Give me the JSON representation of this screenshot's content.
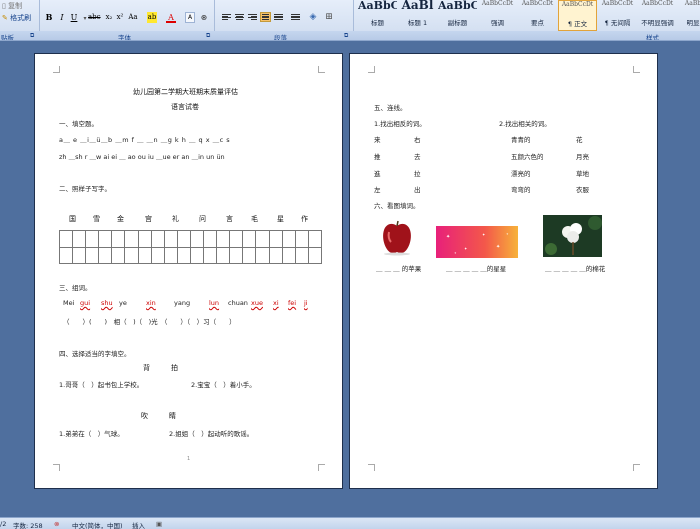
{
  "clipboard": {
    "cut_label": "剪切",
    "copy_label": "复制",
    "format_painter_label": "格式刷"
  },
  "groups": {
    "clipboard": "贴板",
    "font": "字体",
    "paragraph": "段落",
    "styles": "样式"
  },
  "font_toolbar": {
    "bold": "B",
    "italic": "I",
    "underline": "U",
    "strikethrough": "abc",
    "subscript": "x₂",
    "superscript": "x²",
    "change_case": "Aa",
    "highlight": "ab",
    "font_color": "A",
    "char_border": "A",
    "phonetic": "A"
  },
  "styles": [
    {
      "sample": "AaBbC",
      "name": "标题"
    },
    {
      "sample": "AaBl",
      "name": "标题 1"
    },
    {
      "sample": "AaBbC",
      "name": "副标题"
    },
    {
      "sample": "AaBbCcDt",
      "name": "强调"
    },
    {
      "sample": "AaBbCcDt",
      "name": "要点"
    },
    {
      "sample": "AaBbCcDt",
      "name": "正文"
    },
    {
      "sample": "AaBbCcDt",
      "name": "无间隔"
    },
    {
      "sample": "AaBbCcDt",
      "name": "不明显强调"
    },
    {
      "sample": "AaBb",
      "name": "明显"
    }
  ],
  "page1": {
    "title": "幼儿园第二学期大班期末质量评估",
    "subtitle": "语言试卷",
    "sec1": "一、填空题。",
    "fill_row1": "a＿ e ＿i＿ü＿b ＿m f ＿ ＿n ＿g k h ＿ q x ＿c s",
    "fill_row2": [
      "zh",
      "＿sh r",
      "＿w",
      "ai",
      "ei",
      "＿",
      "ao",
      "ou",
      "iu",
      "＿ue",
      "er",
      "an",
      "＿in",
      "un",
      "ün"
    ],
    "sec2": "二、照样子写字。",
    "chars": [
      "国",
      "雪",
      "金",
      "宫",
      "礼",
      "问",
      "言",
      "毛",
      "星",
      "作"
    ],
    "sec3": "三、组词。",
    "pinyin": [
      "Mei",
      "gui",
      "shu",
      "ye",
      "xin",
      "yang",
      "lun",
      "chuan",
      "xue",
      "xi",
      "fei",
      "ji"
    ],
    "word_row": "（　　）(　　)　相（　)（　)光　（　　）（　）习（　　）",
    "sec4": "四、选择适当的字填空。",
    "pair1": "背　　　拍",
    "q1a": "1.哥哥（　）起书包上学校。",
    "q1b": "2.宝宝（　）着小手。",
    "pair2": "吹　　　睛",
    "q2a": "1.弟弟在（　）气球。",
    "q2b": "2.姐姐（　）起动听的歌谣。",
    "page_num": "1"
  },
  "page2": {
    "sec5": "五、连线。",
    "opp_heading": "1.找出相反的词。",
    "rel_heading": "2.找出相关的词。",
    "opposites": [
      [
        "来",
        "右"
      ],
      [
        "推",
        "去"
      ],
      [
        "進",
        "拉"
      ],
      [
        "左",
        "出"
      ]
    ],
    "related": [
      [
        "青青的",
        "花"
      ],
      [
        "五颜六色的",
        "月亮"
      ],
      [
        "漂亮的",
        "草地"
      ],
      [
        "弯弯的",
        "衣服"
      ]
    ],
    "sec6": "六、看图填词。",
    "captions": [
      "＿ ＿ ＿ 的苹果",
      "＿ ＿ ＿ ＿ ＿的星星",
      "＿ ＿ ＿ ＿ ＿的棉花"
    ]
  },
  "status": {
    "page": "/2",
    "words": "字数: 258",
    "lang": "中文(简体，中国)",
    "mode": "插入"
  }
}
